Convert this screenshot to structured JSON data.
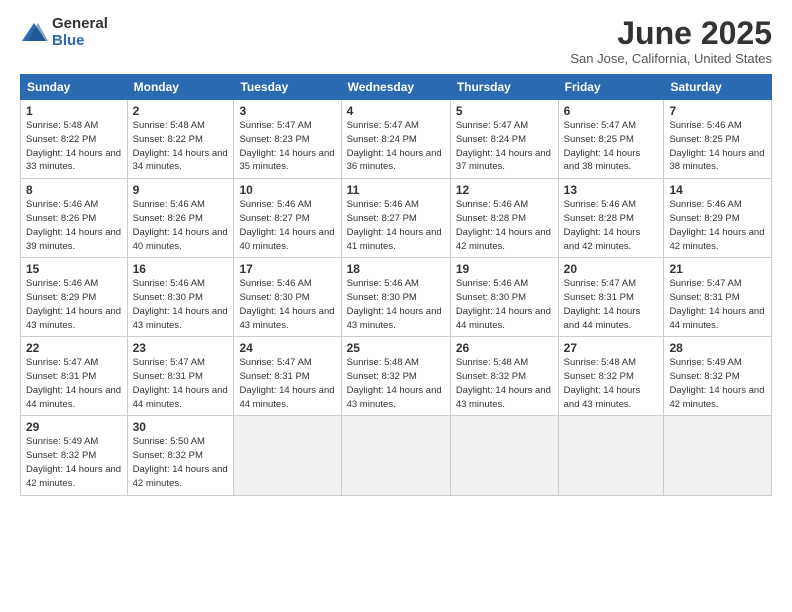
{
  "logo": {
    "general": "General",
    "blue": "Blue"
  },
  "title": "June 2025",
  "location": "San Jose, California, United States",
  "weekdays": [
    "Sunday",
    "Monday",
    "Tuesday",
    "Wednesday",
    "Thursday",
    "Friday",
    "Saturday"
  ],
  "weeks": [
    [
      {
        "day": 1,
        "sunrise": "5:48 AM",
        "sunset": "8:22 PM",
        "daylight": "14 hours and 33 minutes."
      },
      {
        "day": 2,
        "sunrise": "5:48 AM",
        "sunset": "8:22 PM",
        "daylight": "14 hours and 34 minutes."
      },
      {
        "day": 3,
        "sunrise": "5:47 AM",
        "sunset": "8:23 PM",
        "daylight": "14 hours and 35 minutes."
      },
      {
        "day": 4,
        "sunrise": "5:47 AM",
        "sunset": "8:24 PM",
        "daylight": "14 hours and 36 minutes."
      },
      {
        "day": 5,
        "sunrise": "5:47 AM",
        "sunset": "8:24 PM",
        "daylight": "14 hours and 37 minutes."
      },
      {
        "day": 6,
        "sunrise": "5:47 AM",
        "sunset": "8:25 PM",
        "daylight": "14 hours and 38 minutes."
      },
      {
        "day": 7,
        "sunrise": "5:46 AM",
        "sunset": "8:25 PM",
        "daylight": "14 hours and 38 minutes."
      }
    ],
    [
      {
        "day": 8,
        "sunrise": "5:46 AM",
        "sunset": "8:26 PM",
        "daylight": "14 hours and 39 minutes."
      },
      {
        "day": 9,
        "sunrise": "5:46 AM",
        "sunset": "8:26 PM",
        "daylight": "14 hours and 40 minutes."
      },
      {
        "day": 10,
        "sunrise": "5:46 AM",
        "sunset": "8:27 PM",
        "daylight": "14 hours and 40 minutes."
      },
      {
        "day": 11,
        "sunrise": "5:46 AM",
        "sunset": "8:27 PM",
        "daylight": "14 hours and 41 minutes."
      },
      {
        "day": 12,
        "sunrise": "5:46 AM",
        "sunset": "8:28 PM",
        "daylight": "14 hours and 42 minutes."
      },
      {
        "day": 13,
        "sunrise": "5:46 AM",
        "sunset": "8:28 PM",
        "daylight": "14 hours and 42 minutes."
      },
      {
        "day": 14,
        "sunrise": "5:46 AM",
        "sunset": "8:29 PM",
        "daylight": "14 hours and 42 minutes."
      }
    ],
    [
      {
        "day": 15,
        "sunrise": "5:46 AM",
        "sunset": "8:29 PM",
        "daylight": "14 hours and 43 minutes."
      },
      {
        "day": 16,
        "sunrise": "5:46 AM",
        "sunset": "8:30 PM",
        "daylight": "14 hours and 43 minutes."
      },
      {
        "day": 17,
        "sunrise": "5:46 AM",
        "sunset": "8:30 PM",
        "daylight": "14 hours and 43 minutes."
      },
      {
        "day": 18,
        "sunrise": "5:46 AM",
        "sunset": "8:30 PM",
        "daylight": "14 hours and 43 minutes."
      },
      {
        "day": 19,
        "sunrise": "5:46 AM",
        "sunset": "8:30 PM",
        "daylight": "14 hours and 44 minutes."
      },
      {
        "day": 20,
        "sunrise": "5:47 AM",
        "sunset": "8:31 PM",
        "daylight": "14 hours and 44 minutes."
      },
      {
        "day": 21,
        "sunrise": "5:47 AM",
        "sunset": "8:31 PM",
        "daylight": "14 hours and 44 minutes."
      }
    ],
    [
      {
        "day": 22,
        "sunrise": "5:47 AM",
        "sunset": "8:31 PM",
        "daylight": "14 hours and 44 minutes."
      },
      {
        "day": 23,
        "sunrise": "5:47 AM",
        "sunset": "8:31 PM",
        "daylight": "14 hours and 44 minutes."
      },
      {
        "day": 24,
        "sunrise": "5:47 AM",
        "sunset": "8:31 PM",
        "daylight": "14 hours and 44 minutes."
      },
      {
        "day": 25,
        "sunrise": "5:48 AM",
        "sunset": "8:32 PM",
        "daylight": "14 hours and 43 minutes."
      },
      {
        "day": 26,
        "sunrise": "5:48 AM",
        "sunset": "8:32 PM",
        "daylight": "14 hours and 43 minutes."
      },
      {
        "day": 27,
        "sunrise": "5:48 AM",
        "sunset": "8:32 PM",
        "daylight": "14 hours and 43 minutes."
      },
      {
        "day": 28,
        "sunrise": "5:49 AM",
        "sunset": "8:32 PM",
        "daylight": "14 hours and 42 minutes."
      }
    ],
    [
      {
        "day": 29,
        "sunrise": "5:49 AM",
        "sunset": "8:32 PM",
        "daylight": "14 hours and 42 minutes."
      },
      {
        "day": 30,
        "sunrise": "5:50 AM",
        "sunset": "8:32 PM",
        "daylight": "14 hours and 42 minutes."
      },
      null,
      null,
      null,
      null,
      null
    ]
  ]
}
